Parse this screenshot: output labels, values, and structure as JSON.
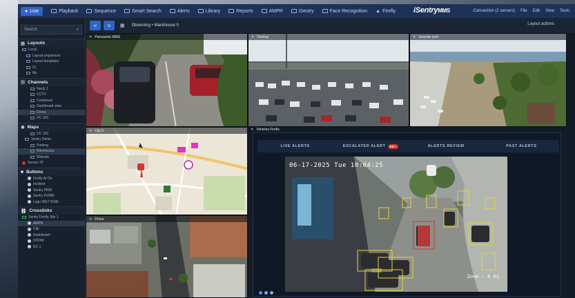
{
  "menubar": {
    "live": "Live",
    "items": [
      "Playback",
      "Sequence",
      "Smart Search",
      "Alerts",
      "Library",
      "Reports",
      "AMPR",
      "iSentry",
      "Face Recognition",
      "Firefly"
    ],
    "brand_main": "iSentry",
    "brand_sub": "MMS",
    "connection": "Connection (2 servers)",
    "right_items": [
      "File",
      "Edit",
      "View",
      "Tools"
    ]
  },
  "sidebar": {
    "search_placeholder": "Search",
    "sections": {
      "layouts": "Layouts",
      "channels": "Channels",
      "maps": "Maps",
      "buttons": "Buttons",
      "crosslinks": "Crosslinks"
    },
    "layouts_items": [
      "Local",
      "Layout sequences",
      "Layout templates",
      "01",
      "My"
    ],
    "channels_items": [
      "Nexly 1",
      "CCTV",
      "Combined",
      "Dashboard view",
      "Drone",
      "DC 100"
    ],
    "maps_items": [
      "DC 100",
      "Sentry Demo",
      "Parking",
      "Warehouse",
      "Website",
      "Sensor #2"
    ],
    "buttons_items": [
      "Firefly AI On",
      "Incident",
      "Sentry PRM",
      "Sentry DVMR",
      "Logo MGT ROM"
    ],
    "crosslinks_items": [
      "Sentry Firefly Site 1",
      "AMPR",
      "City",
      "Dashboard",
      "DOOM",
      "DC 1"
    ]
  },
  "toolbar": {
    "back": "<",
    "forward": ">",
    "breadcrumb": "Observing • Warehouse 0",
    "layout_actions": "Layout actions"
  },
  "tiles": {
    "panoramic": "Panoramic MMS",
    "parking": "Parking",
    "seaside": "Seaside park",
    "city": "City 6",
    "drone": "Drone",
    "vehicles": "Vehicles Firefly"
  },
  "alerts": {
    "tabs": [
      "LIVE ALERTS",
      "ESCALATED ALERT",
      "ALERTS REVIEW",
      "PAST ALERTS"
    ],
    "escalated_count": "99+",
    "timestamp": "06-17-2025 Tue 10:04:25",
    "zone": "Zone - A 01"
  },
  "colors": {
    "accent": "#2f63c9",
    "menubar": "#1e3157",
    "detection": "#e8d433",
    "alert_red": "#d4352f"
  }
}
